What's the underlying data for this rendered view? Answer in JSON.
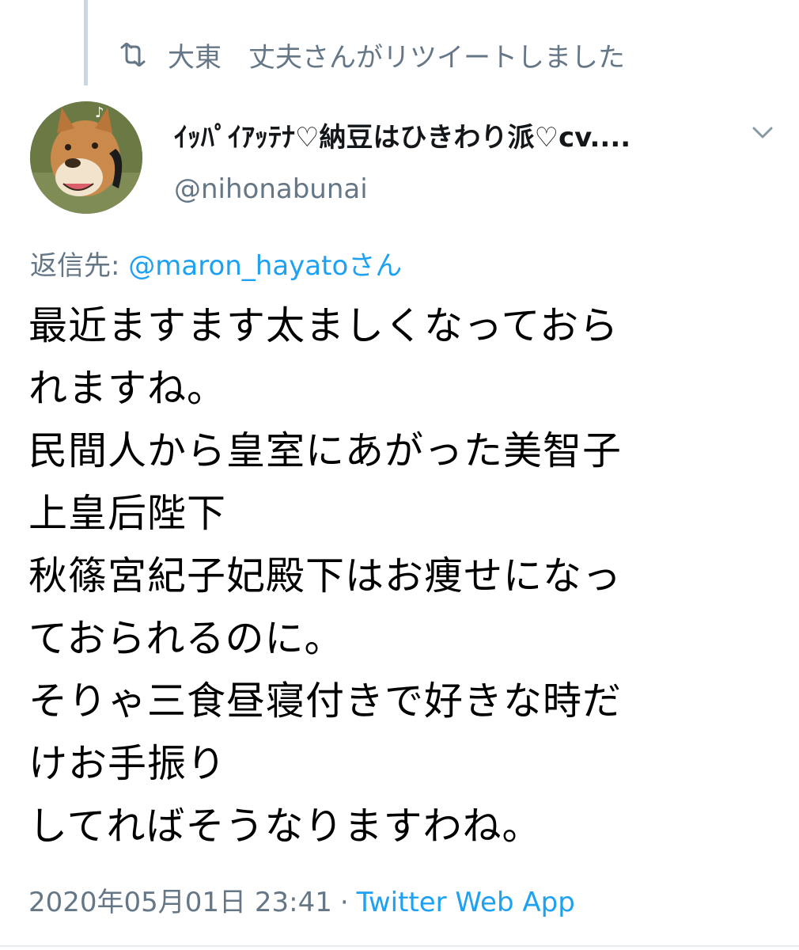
{
  "retweet": {
    "icon": "retweet-icon",
    "text": "大東　丈夫さんがリツイートしました"
  },
  "author": {
    "avatar_icon": "shiba-dog-avatar",
    "display_name": "ｲｯﾊﾟｲｱｯﾃﾅ♡納豆はひきわり派♡cv....",
    "handle": "@nihonabunai",
    "menu_icon": "chevron-down-icon"
  },
  "reply": {
    "label": "返信先: ",
    "mention": "@maron_hayatoさん"
  },
  "tweet": {
    "text": "最近ますます太ましくなっておら\nれますね。\n民間人から皇室にあがった美智子\n上皇后陛下\n秋篠宮紀子妃殿下はお痩せになっ\nておられるのに。\nそりゃ三食昼寝付きで好きな時だ\nけお手振り\nしてればそうなりますわね。"
  },
  "meta": {
    "timestamp": "2020年05月01日 23:41",
    "separator": "·",
    "source": "Twitter Web App"
  },
  "colors": {
    "secondary_text": "#657786",
    "link": "#1da1f2",
    "thread_line": "#ccd6dd"
  }
}
